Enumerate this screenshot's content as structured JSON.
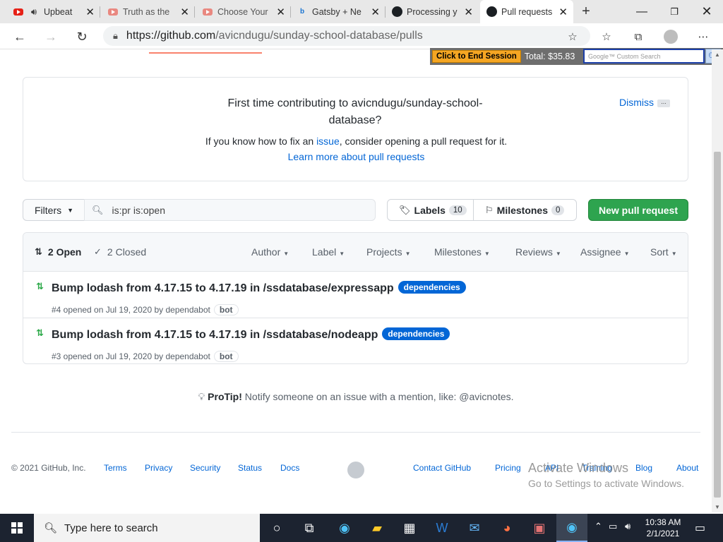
{
  "browser": {
    "tabs": [
      {
        "title": "Upbeat",
        "icon": "youtube-icon"
      },
      {
        "title": "Truth as the",
        "icon": "youtube-icon"
      },
      {
        "title": "Choose Your",
        "icon": "youtube-icon"
      },
      {
        "title": "Gatsby + Ne",
        "icon": "bing-icon"
      },
      {
        "title": "Processing y",
        "icon": "github-icon"
      },
      {
        "title": "Pull requests",
        "icon": "github-icon"
      }
    ],
    "url_host": "https://github.com",
    "url_path": "/avicndugu/sunday-school-database/pulls"
  },
  "session_bar": {
    "end_label": "Click to End Session",
    "total": "Total: $35.83",
    "search_placeholder": "Google™ Custom Search"
  },
  "first_time": {
    "heading": "First time contributing to avicndugu/sunday-school-database?",
    "line_pre": "If you know how to fix an ",
    "line_link": "issue",
    "line_post": ", consider opening a pull request for it.",
    "learn_more": "Learn more about pull requests",
    "dismiss": "Dismiss",
    "more": "..."
  },
  "filter_bar": {
    "filters_label": "Filters",
    "search_value": "is:pr is:open",
    "labels_label": "Labels",
    "labels_count": "10",
    "milestones_label": "Milestones",
    "milestones_count": "0",
    "new_pr_label": "New pull request"
  },
  "list_header": {
    "open": "2 Open",
    "closed": "2 Closed",
    "dropdowns": [
      "Author",
      "Label",
      "Projects",
      "Milestones",
      "Reviews",
      "Assignee",
      "Sort"
    ]
  },
  "pull_requests": [
    {
      "title": "Bump lodash from 4.17.15 to 4.17.19 in /ssdatabase/expressapp",
      "label": "dependencies",
      "meta": "#4 opened on Jul 19, 2020 by dependabot",
      "badge": "bot"
    },
    {
      "title": "Bump lodash from 4.17.15 to 4.17.19 in /ssdatabase/nodeapp",
      "label": "dependencies",
      "meta": "#3 opened on Jul 19, 2020 by dependabot",
      "badge": "bot"
    }
  ],
  "protip": {
    "bold": "ProTip!",
    "text": " Notify someone on an issue with a mention, like: @avicnotes."
  },
  "footer": {
    "copyright": "© 2021 GitHub, Inc.",
    "links_left": [
      "Terms",
      "Privacy",
      "Security",
      "Status",
      "Docs"
    ],
    "links_right": [
      "Contact GitHub",
      "Pricing",
      "API",
      "Training",
      "Blog",
      "About"
    ]
  },
  "watermark": {
    "line1": "Activate Windows",
    "line2": "Go to Settings to activate Windows."
  },
  "taskbar": {
    "search_placeholder": "Type here to search",
    "time": "10:38 AM",
    "date": "2/1/2021"
  },
  "colors": {
    "accent_green": "#2ea44f",
    "link_blue": "#0366d6",
    "label_blue": "#0366d6",
    "open_icon_green": "#28a745"
  }
}
